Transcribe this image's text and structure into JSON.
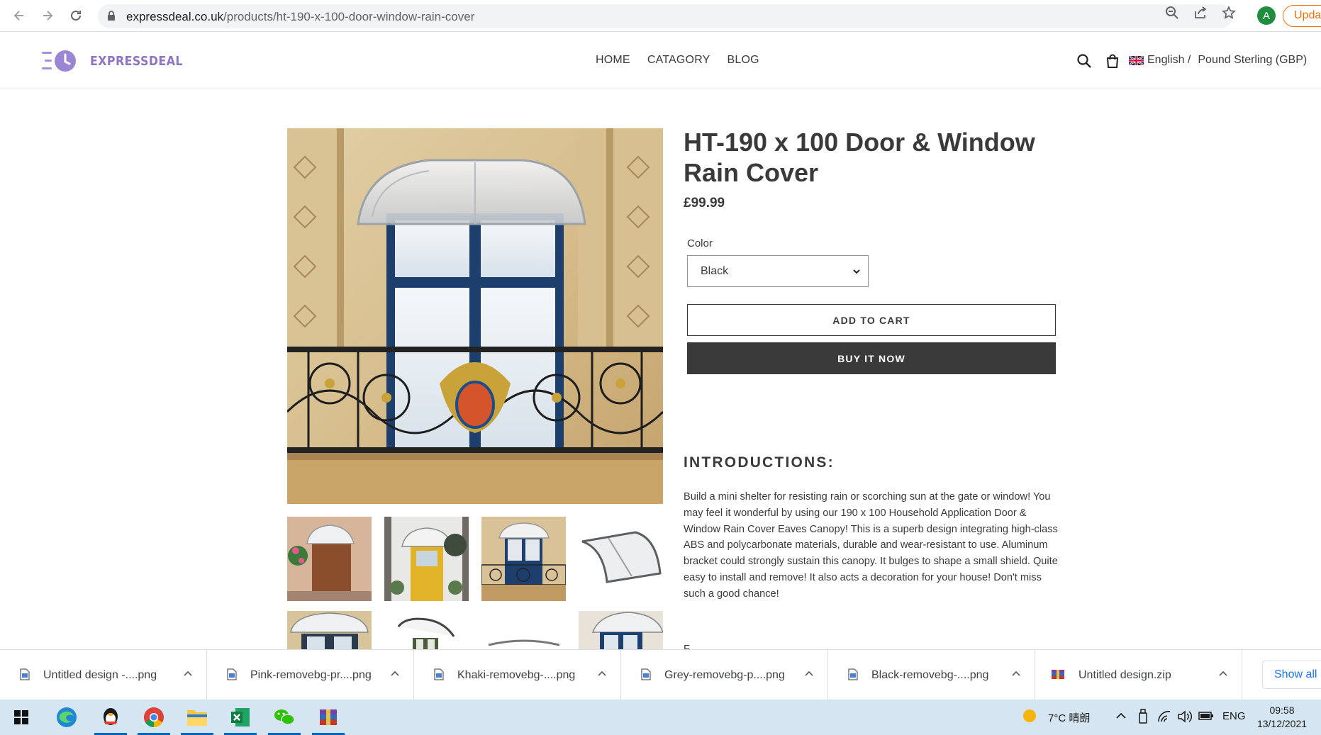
{
  "browser": {
    "url_domain": "expressdeal.co.uk",
    "url_path": "/products/ht-190-x-100-door-window-rain-cover",
    "profile_initial": "A",
    "update_label": "Updat"
  },
  "site": {
    "logo_text": "EXPRESSDEAL",
    "nav": [
      "HOME",
      "CATAGORY",
      "BLOG"
    ],
    "language": "English /",
    "currency": "Pound Sterling (GBP)"
  },
  "product": {
    "title": "HT-190 x 100 Door & Window Rain Cover",
    "price": "£99.99",
    "color_label": "Color",
    "color_value": "Black",
    "add_to_cart": "ADD TO CART",
    "buy_now": "BUY IT NOW",
    "intro_heading": "INTRODUCTIONS:",
    "intro_body": "Build a mini shelter for resisting rain or scorching sun at the gate or window! You may feel it wonderful by using our 190 x 100 Household Application Door & Window Rain Cover Eaves Canopy! This is a superb design integrating high-class ABS and polycarbonate materials, durable and wear-resistant to use. Aluminum bracket could strongly sustain this canopy. It bulges to shape a small shield. Quite easy to install and remove! It also acts a decoration for your house! Don't miss such a good chance!",
    "next_line_peek": "F"
  },
  "downloads": {
    "items": [
      {
        "name": "Untitled design -....png",
        "icon": "image-file-icon"
      },
      {
        "name": "Pink-removebg-pr....png",
        "icon": "image-file-icon"
      },
      {
        "name": "Khaki-removebg-....png",
        "icon": "image-file-icon"
      },
      {
        "name": "Grey-removebg-p....png",
        "icon": "image-file-icon"
      },
      {
        "name": "Black-removebg-....png",
        "icon": "image-file-icon"
      },
      {
        "name": "Untitled design.zip",
        "icon": "zip-file-icon"
      }
    ],
    "show_all": "Show all"
  },
  "taskbar": {
    "weather": "7°C 晴朗",
    "lang": "ENG",
    "time": "09:58",
    "date": "13/12/2021"
  }
}
